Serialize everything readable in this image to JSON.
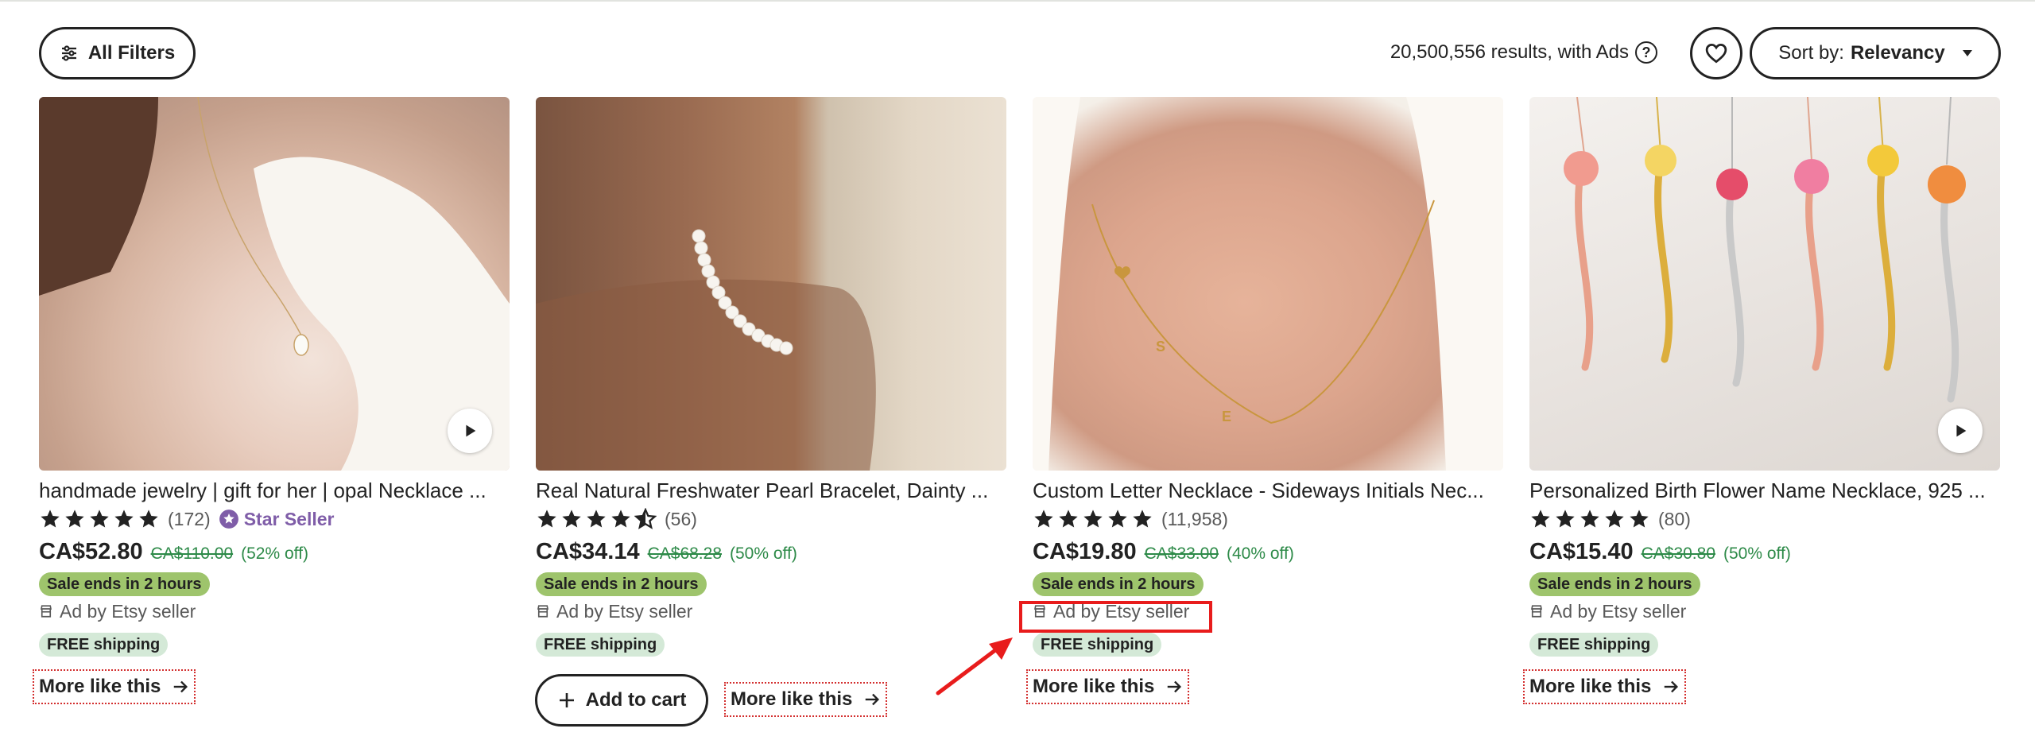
{
  "toolbar": {
    "filters_label": "All Filters",
    "results_text": "20,500,556 results, with Ads",
    "help_icon": "question-circle-icon",
    "favorite_icon": "heart-icon",
    "sort_prefix": "Sort by:",
    "sort_value": "Relevancy"
  },
  "colors": {
    "accent_green": "#2d8a48",
    "sale_badge_bg": "#9ec46c",
    "shipping_badge_bg": "#d4e9d7",
    "star_seller_purple": "#7f5da8",
    "annotation_red": "#e81c1c"
  },
  "products": [
    {
      "title": "handmade jewelry | gift for her | opal Necklace ...",
      "rating": 5,
      "reviews": "(172)",
      "star_seller": "Star Seller",
      "price": "CA$52.80",
      "original_price": "CA$110.00",
      "discount": "(52% off)",
      "sale_badge": "Sale ends in 2 hours",
      "ad_label": "Ad by Etsy seller",
      "shipping": "FREE shipping",
      "more_like": "More like this",
      "has_video": true
    },
    {
      "title": "Real Natural Freshwater Pearl Bracelet, Dainty ...",
      "rating": 4.5,
      "reviews": "(56)",
      "price": "CA$34.14",
      "original_price": "CA$68.28",
      "discount": "(50% off)",
      "sale_badge": "Sale ends in 2 hours",
      "ad_label": "Ad by Etsy seller",
      "shipping": "FREE shipping",
      "add_to_cart": "Add to cart",
      "more_like": "More like this",
      "has_video": false
    },
    {
      "title": "Custom Letter Necklace - Sideways Initials Nec...",
      "rating": 5,
      "reviews": "(11,958)",
      "price": "CA$19.80",
      "original_price": "CA$33.00",
      "discount": "(40% off)",
      "sale_badge": "Sale ends in 2 hours",
      "ad_label": "Ad by Etsy seller",
      "shipping": "FREE shipping",
      "more_like": "More like this",
      "has_video": false
    },
    {
      "title": "Personalized Birth Flower Name Necklace, 925 ...",
      "rating": 5,
      "reviews": "(80)",
      "price": "CA$15.40",
      "original_price": "CA$30.80",
      "discount": "(50% off)",
      "sale_badge": "Sale ends in 2 hours",
      "ad_label": "Ad by Etsy seller",
      "shipping": "FREE shipping",
      "more_like": "More like this",
      "has_video": true
    }
  ]
}
